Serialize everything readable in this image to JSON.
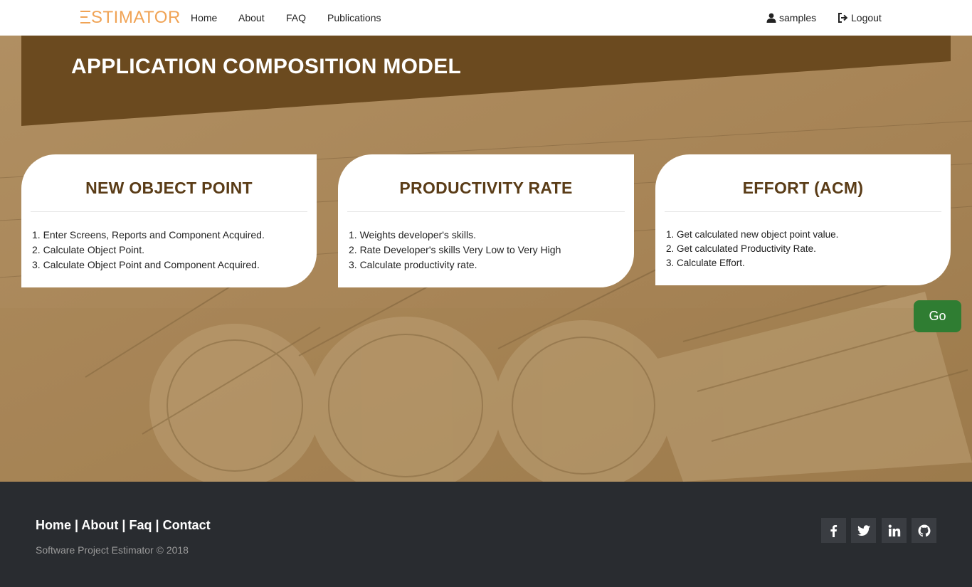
{
  "nav": {
    "brand": "ESTIMATOR",
    "brand_color": "#f0a355",
    "links": [
      "Home",
      "About",
      "FAQ",
      "Publications"
    ],
    "user": "samples",
    "logout": "Logout"
  },
  "banner": {
    "title": "APPLICATION COMPOSITION MODEL",
    "color": "#6b4a1f"
  },
  "cards": [
    {
      "title": "NEW OBJECT POINT",
      "items": [
        "1. Enter Screens, Reports and Component Acquired.",
        "2. Calculate Object Point.",
        "3. Calculate Object Point and Component Acquired."
      ]
    },
    {
      "title": "PRODUCTIVITY RATE",
      "items": [
        "1. Weights developer's skills.",
        "2. Rate Developer's skills Very Low to Very High",
        "3. Calculate productivity rate."
      ]
    },
    {
      "title": "EFFORT (ACM)",
      "items": [
        "1. Get calculated new object point value.",
        "2. Get calculated Productivity Rate.",
        "3. Calculate Effort."
      ]
    }
  ],
  "go_button": {
    "label": "Go",
    "color": "#2f7d32"
  },
  "footer": {
    "links": [
      "Home",
      "About",
      "Faq",
      "Contact"
    ],
    "separator": "|",
    "copyright": "Software Project Estimator © 2018",
    "social_icons": [
      "facebook-icon",
      "twitter-icon",
      "linkedin-icon",
      "github-icon"
    ]
  }
}
